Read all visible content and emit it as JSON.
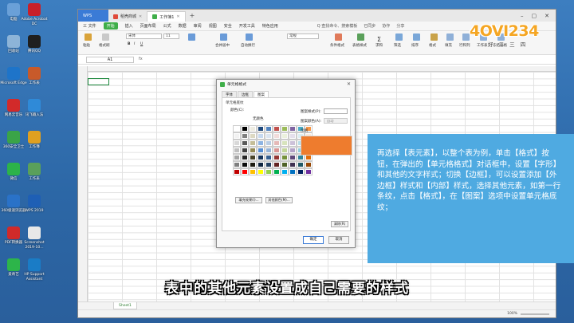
{
  "desktop": {
    "icons": [
      {
        "label": "电脑",
        "color": "#6aa0d8"
      },
      {
        "label": "Adobe Acrobat DC",
        "color": "#c8202a"
      },
      {
        "label": "回收站",
        "color": "#8db4d8"
      },
      {
        "label": "腾讯QQ",
        "color": "#1f1f1f"
      },
      {
        "label": "Microsoft Edge",
        "color": "#1e74c9"
      },
      {
        "label": "工作表",
        "color": "#c85a2a"
      },
      {
        "label": "网易云音乐",
        "color": "#d22a2a"
      },
      {
        "label": "讯飞输入法",
        "color": "#2f8ad8"
      },
      {
        "label": "360安全卫士",
        "color": "#3aa448"
      },
      {
        "label": "工作簿",
        "color": "#e0a020"
      },
      {
        "label": "微信",
        "color": "#2cb34a"
      },
      {
        "label": "工作表",
        "color": "#5aa05a"
      },
      {
        "label": "360极速浏览器",
        "color": "#2a72c8"
      },
      {
        "label": "WPS 2019",
        "color": "#1e5fb5"
      },
      {
        "label": "PDF转换器",
        "color": "#d02a2a"
      },
      {
        "label": "Screenshot 2019-10...",
        "color": "#e8e8e8"
      },
      {
        "label": "爱奇艺",
        "color": "#2db54a"
      },
      {
        "label": "HP Support Assistant",
        "color": "#1a7cc6"
      }
    ]
  },
  "window": {
    "tabs": [
      {
        "label": "WPS"
      },
      {
        "label": "稻壳商城"
      },
      {
        "label": "工作簿1"
      }
    ],
    "menu": [
      "三 文件",
      "开始",
      "插入",
      "页面布局",
      "公式",
      "数据",
      "审阅",
      "视图",
      "安全",
      "开发工具",
      "特色应用"
    ],
    "menu_right": [
      "Q 查找命令、搜索模板",
      "已同步",
      "协作",
      "分享"
    ],
    "ribbon": {
      "font_name": "宋体",
      "font_size": "11",
      "number_format": "常规",
      "labels": [
        "粘贴",
        "格式刷",
        "合并居中",
        "自动换行",
        "条件格式",
        "表格样式",
        "求和",
        "筛选",
        "排序",
        "格式",
        "填充",
        "行和列",
        "工作表",
        "冻结窗格",
        "文档助手"
      ]
    },
    "namebox": "A1",
    "fx": "fx",
    "sheet": "Sheet1",
    "zoom": "100%"
  },
  "dialog": {
    "title": "单元格格式",
    "tabs": [
      "字体",
      "边框",
      "图案"
    ],
    "active_tab": "图案",
    "section": "单元格底纹",
    "color_label": "颜色(C):",
    "no_color": "无颜色",
    "palette": [
      "#ffffff",
      "#000000",
      "#eeece1",
      "#1f497d",
      "#4f81bd",
      "#c0504d",
      "#9bbb59",
      "#8064a2",
      "#4bacc6",
      "#f79646",
      "#f2f2f2",
      "#7f7f7f",
      "#ddd9c3",
      "#c6d9f0",
      "#dbe5f1",
      "#f2dcdb",
      "#ebf1dd",
      "#e5e0ec",
      "#dbeef3",
      "#fdeada",
      "#d8d8d8",
      "#595959",
      "#c4bd97",
      "#8db3e2",
      "#b8cce4",
      "#e5b9b7",
      "#d7e3bc",
      "#ccc1d9",
      "#b7dde8",
      "#fbd5b5",
      "#bfbfbf",
      "#3f3f3f",
      "#938953",
      "#548dd4",
      "#95b3d7",
      "#d99694",
      "#c3d69b",
      "#b2a2c7",
      "#92cddc",
      "#fac08f",
      "#a5a5a5",
      "#262626",
      "#494429",
      "#17365d",
      "#366092",
      "#953734",
      "#76923c",
      "#5f497a",
      "#31859b",
      "#e36c09",
      "#7f7f7f",
      "#0c0c0c",
      "#1d1b10",
      "#0f243e",
      "#244061",
      "#632423",
      "#4f6128",
      "#3f3151",
      "#205867",
      "#974806",
      "#c00000",
      "#ff0000",
      "#ffc000",
      "#ffff00",
      "#92d050",
      "#00b050",
      "#00b0f0",
      "#0070c0",
      "#002060",
      "#7030a0"
    ],
    "fill_effect_button": "填充效果(I)...",
    "more_colors_button": "其他颜色(M)...",
    "pattern_style_label": "图案样式(P):",
    "pattern_color_label": "图案颜色(A):",
    "pattern_color_value": "自动",
    "sample_label": "示例",
    "sample_color": "#ee7c2e",
    "clear_button": "清除(R)",
    "ok_button": "确定",
    "cancel_button": "取消"
  },
  "overlay": {
    "info_text": "再选择【表元素】，以整个表为例，单击【格式】按钮，在弹出的【单元格格式】对话框中，设置【字形】和其他的文字样式；切换【边框】，可以设置添加【外边框】样式和【内部】样式，选择其他元素，如第一行条纹，点击【格式】，在【图案】选项中设置单元格底纹；",
    "info_bg": "#4faae1",
    "subtitle": "表中的其他元素设置成自己需要的样式",
    "logo_text": "4OVI234",
    "logo_sub": "好 二 三 四",
    "logo_color": "#f5a623"
  }
}
